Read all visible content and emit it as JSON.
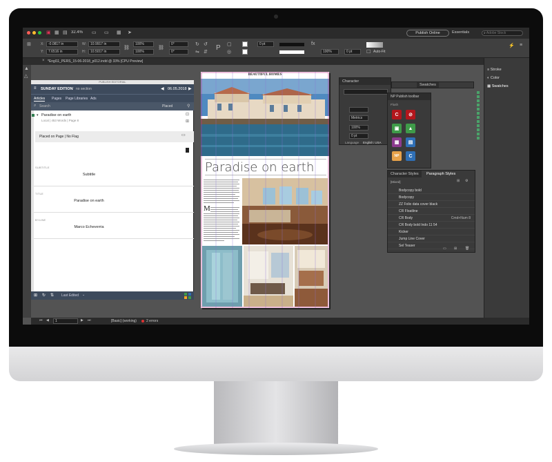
{
  "app": {
    "zoom": "32.4%",
    "publish_button": "Publish Online",
    "workspace": "Essentials",
    "search_placeholder": "Adobe Stock",
    "x_value": "-0.0817 in",
    "y_value": "7.6516 in",
    "w_value": "10.9917 in",
    "h_value": "10.5017 in",
    "scale_x": "100%",
    "scale_y": "100%",
    "rotate": "0°",
    "shear": "0°",
    "stroke_weight": "0 pt",
    "opacity": "100%",
    "stroke_pt": "0 pt",
    "autofit": "Auto-Fit",
    "document_tab": "*Engl11_PERS_15-06-2018_p012.indd @ 33% [CPU Preview]",
    "status_page": "1",
    "status_profile": "[Basic] (working)",
    "status_errors": "2 errors"
  },
  "np_panel": {
    "top_title": "PUBLISH EDITORIAL",
    "edition": "SUNDAY EDITION",
    "section": "no section",
    "date": "06.05.2018",
    "tabs": [
      "Articles",
      "Pages",
      "Page Libraries",
      "Ads"
    ],
    "search_placeholder": "Search",
    "filter_label": "Placed",
    "article_title": "Paradise on earth",
    "article_meta": "Local | 453 Words | Page 8",
    "flag_text": "Placed on Page | No Flag",
    "fields": [
      {
        "label": "SUBTITLE",
        "value": "Subtitle"
      },
      {
        "label": "TITLE",
        "value": "Paradise on earth"
      },
      {
        "label": "BYLINE",
        "value": "Marco Echeverria"
      }
    ],
    "bottom_status": "Last Edited"
  },
  "page": {
    "headline": "Paradise on earth",
    "masthead": "BEAUTIFUL HOMES",
    "drop_cap": "M"
  },
  "character_panel": {
    "title": "Character",
    "kerning": "Metrics",
    "scale": "100%",
    "baseline": "0 pt",
    "language_label": "Language",
    "language": "English: USA"
  },
  "np_toolbar": {
    "title": "NP Publish toolbar",
    "section": "Flush",
    "label": "NP"
  },
  "swatches_tab": "Swatches",
  "styles_panel": {
    "tabs": [
      "Character Styles",
      "Paragraph Styles"
    ],
    "group": "[Mixed]",
    "items": [
      {
        "name": "Bodycopy bold",
        "shortcut": ""
      },
      {
        "name": "Bodycopy",
        "shortcut": ""
      },
      {
        "name": "ZZ Folio data cover black",
        "shortcut": ""
      },
      {
        "name": "CR Floatline",
        "shortcut": ""
      },
      {
        "name": "CR Body",
        "shortcut": "Cmd+Num 8"
      },
      {
        "name": "CR Body bold Indo 11 54",
        "shortcut": ""
      },
      {
        "name": "Kicker",
        "shortcut": ""
      },
      {
        "name": "Jump Line Cover",
        "shortcut": ""
      },
      {
        "name": "Sel Teaser",
        "shortcut": ""
      }
    ]
  },
  "right_dock": [
    "Stroke",
    "Color",
    "Swatches"
  ],
  "colors": {
    "np_header": "#3d4a5c",
    "np_accent": "#2e7d4f",
    "np_red": "#b3161c",
    "np_green": "#3f9b49",
    "np_purple": "#8c3b8e",
    "np_blue": "#2f6fb5"
  }
}
